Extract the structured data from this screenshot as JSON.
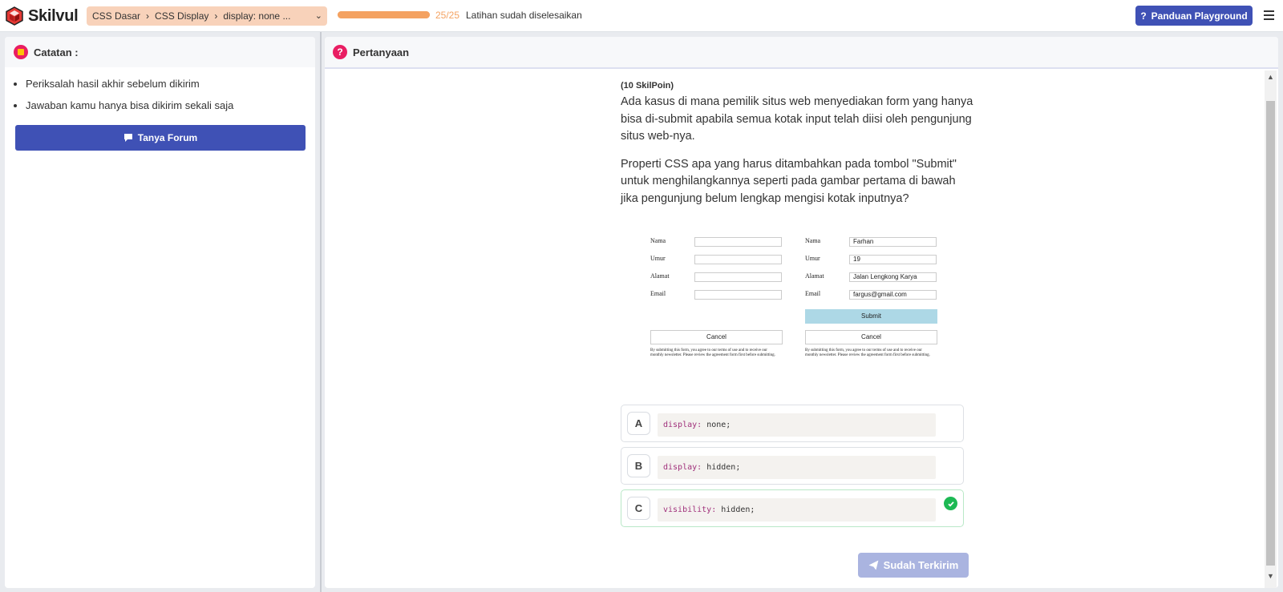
{
  "header": {
    "logo_text": "Skilvul",
    "breadcrumbs": [
      "CSS Dasar",
      "CSS Display",
      "display: none ..."
    ],
    "progress": {
      "count": "25/25",
      "fraction": 1.0,
      "status": "Latihan sudah diselesaikan",
      "color": "#f4a261"
    },
    "guide_button": "Panduan Playground"
  },
  "notes": {
    "title": "Catatan :",
    "items": [
      "Periksalah hasil akhir sebelum dikirim",
      "Jawaban kamu hanya bisa dikirim sekali saja"
    ],
    "forum_button": "Tanya Forum"
  },
  "question": {
    "title": "Pertanyaan",
    "points": "(10 SkilPoin)",
    "paragraph_1": "Ada kasus di mana pemilik situs web menyediakan form yang hanya bisa di-submit apabila semua kotak input telah diisi oleh pengunjung situs web-nya.",
    "paragraph_2": "Properti CSS apa yang harus ditambahkan pada tombol \"Submit\" untuk menghilangkannya seperti pada gambar pertama di bawah jika pengunjung belum lengkap mengisi kotak inputnya?",
    "illustration": {
      "labels": [
        "Nama",
        "Umur",
        "Alamat",
        "Email"
      ],
      "filled_values": [
        "Farhan",
        "19",
        "Jalan Lengkong Karya",
        "fargus@gmail.com"
      ],
      "submit_label": "Submit",
      "cancel_label": "Cancel",
      "disclaimer": "By submitting this form, you agree to our terms of use and to receive our monthly newsletter. Please review the agreement form first before submitting."
    }
  },
  "options": [
    {
      "letter": "A",
      "property": "display",
      "value": "none",
      "correct": false
    },
    {
      "letter": "B",
      "property": "display",
      "value": "hidden",
      "correct": false
    },
    {
      "letter": "C",
      "property": "visibility",
      "value": "hidden",
      "correct": true
    }
  ],
  "submit_button": "Sudah Terkirim",
  "colors": {
    "primary": "#3f51b5",
    "accent_pink": "#e91e63",
    "breadcrumb_bg": "#f8d2ba",
    "correct_green": "#1db954"
  }
}
